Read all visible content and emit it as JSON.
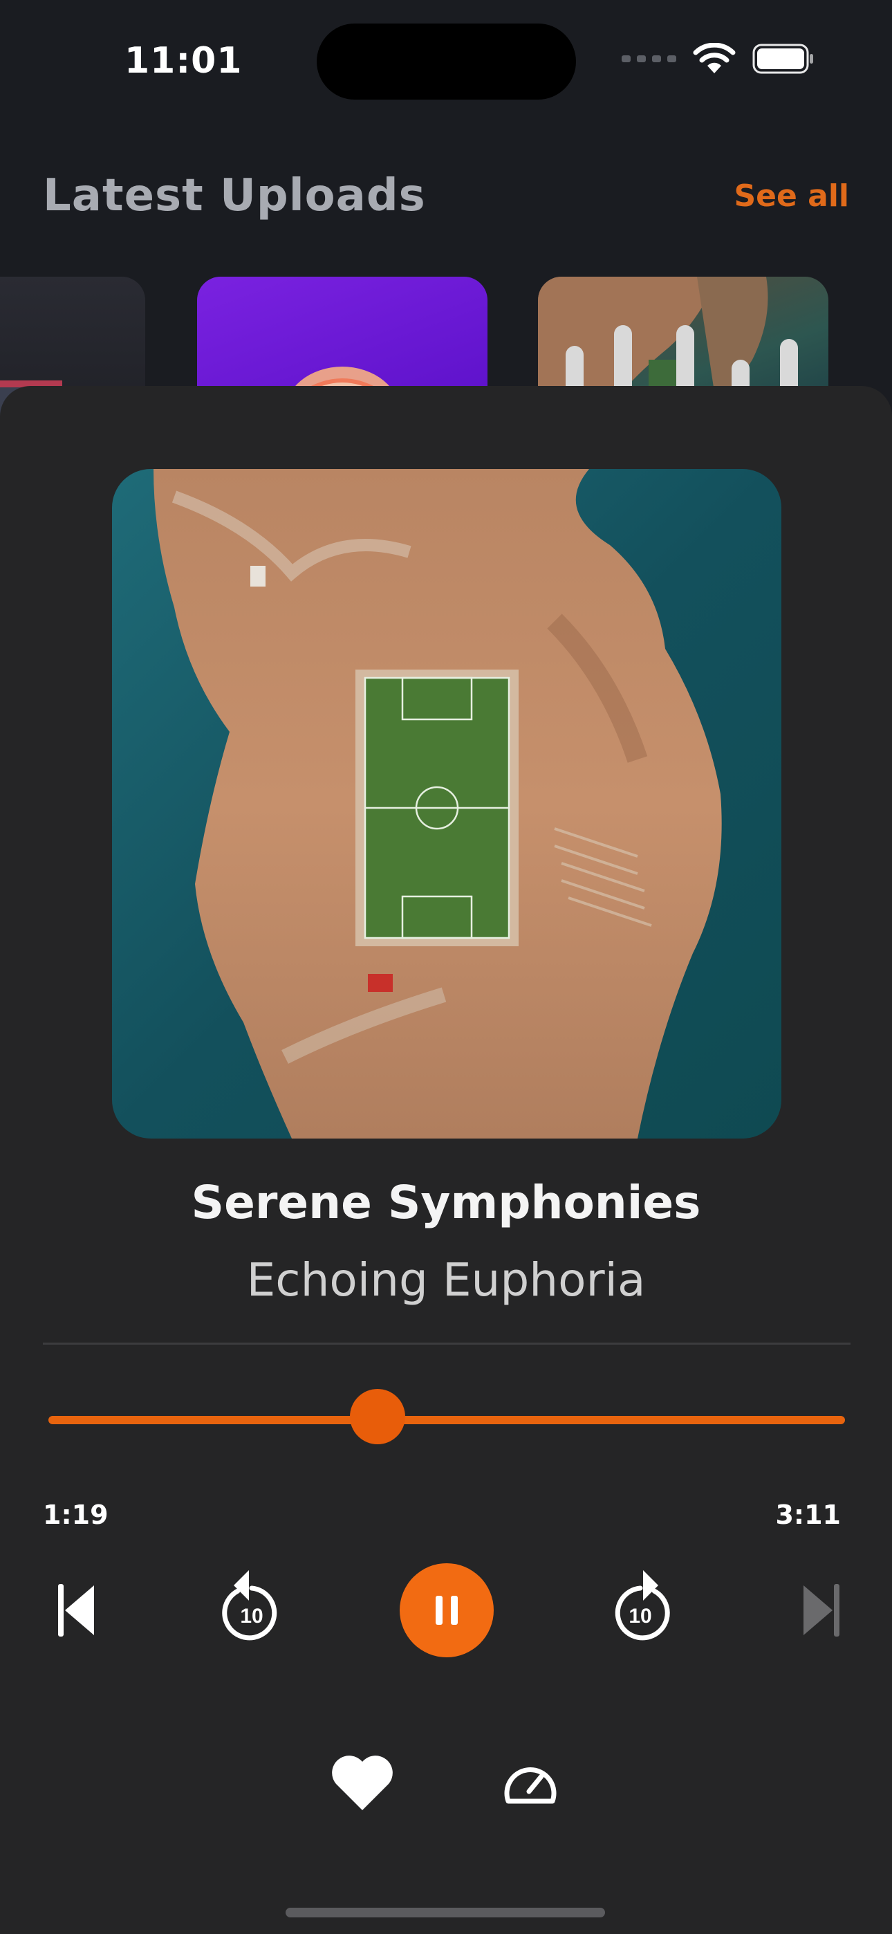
{
  "status_bar": {
    "time": "11:01"
  },
  "header": {
    "title": "Latest Uploads",
    "see_all": "See all"
  },
  "player": {
    "title": "Serene Symphonies",
    "artist": "Echoing Euphoria",
    "elapsed": "1:19",
    "duration": "3:11",
    "progress": 0.4136,
    "skip_seconds": "10",
    "accent_color": "#f26b12"
  },
  "icons": {
    "previous": "skip-previous-icon",
    "rewind": "rewind-10-icon",
    "pause": "pause-icon",
    "forward": "forward-10-icon",
    "next": "skip-next-icon",
    "favorite": "heart-icon",
    "speed": "speedometer-icon"
  }
}
